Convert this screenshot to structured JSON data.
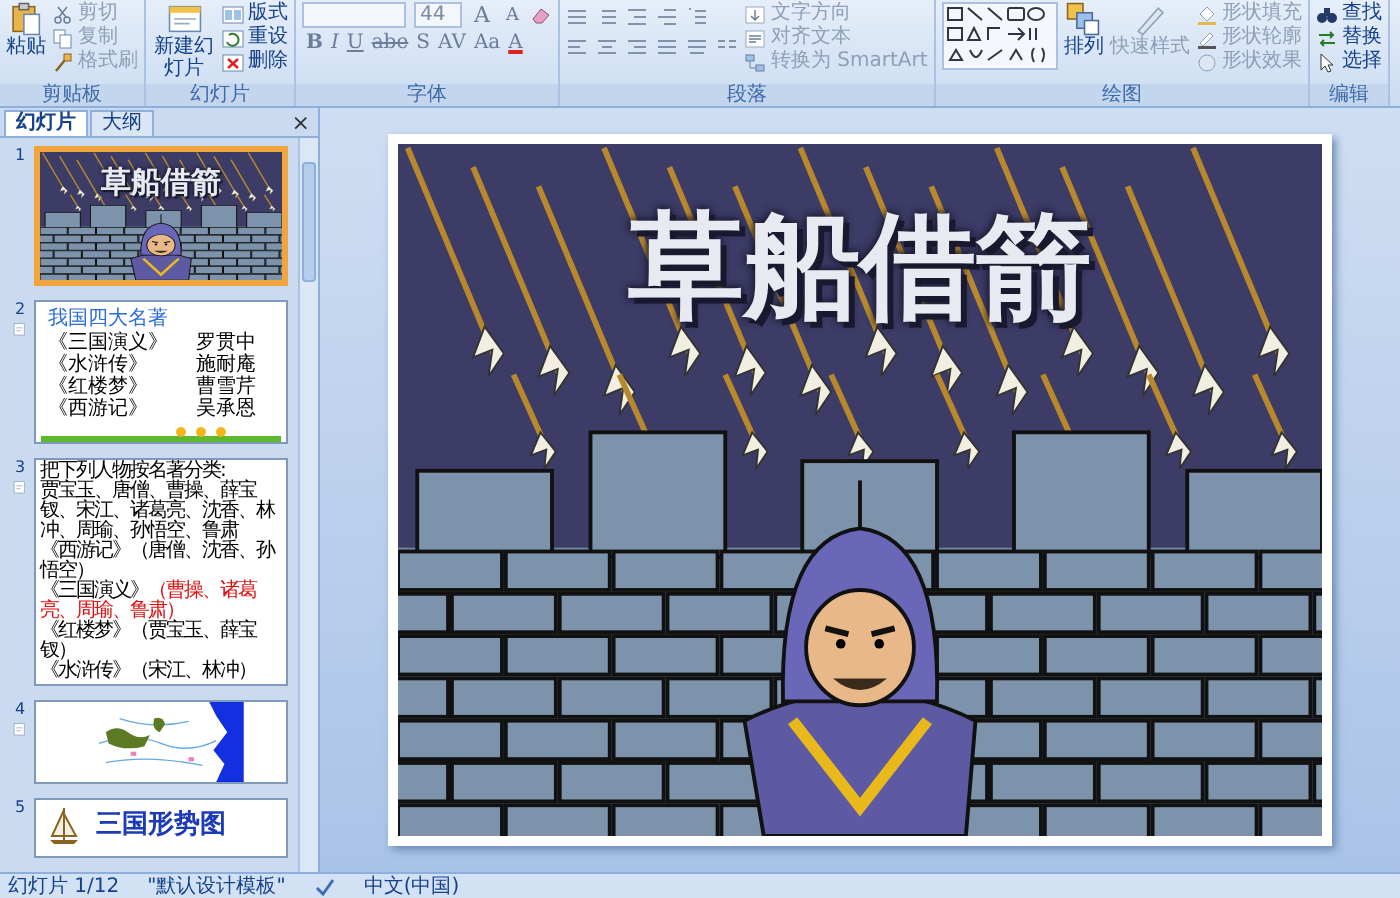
{
  "ribbon": {
    "groups": [
      {
        "kind": "clipboard",
        "label": "剪贴板",
        "large": [
          {
            "label": "粘贴",
            "disabled": false
          }
        ],
        "small": [
          {
            "label": "剪切",
            "disabled": true
          },
          {
            "label": "复制",
            "disabled": true
          },
          {
            "label": "格式刷",
            "disabled": true
          }
        ]
      },
      {
        "kind": "slides",
        "label": "幻灯片",
        "large": [
          {
            "label": "新建幻灯片",
            "disabled": false
          }
        ],
        "small": [
          {
            "label": "版式",
            "disabled": false
          },
          {
            "label": "重设",
            "disabled": false
          },
          {
            "label": "删除",
            "disabled": false
          }
        ]
      },
      {
        "kind": "font",
        "label": "字体",
        "font_size": "44",
        "size_buttons": [
          "A",
          "A"
        ],
        "format_buttons": [
          "B",
          "I",
          "U",
          "abe",
          "S",
          "AV",
          "Aa",
          "A"
        ]
      },
      {
        "kind": "paragraph",
        "label": "段落",
        "small": [
          {
            "label": "文字方向",
            "disabled": true
          },
          {
            "label": "对齐文本",
            "disabled": true
          },
          {
            "label": "转换为 SmartArt",
            "disabled": true
          }
        ]
      },
      {
        "kind": "drawing",
        "label": "绘图",
        "large": [
          {
            "label": "排列",
            "disabled": false
          },
          {
            "label": "快速样式",
            "disabled": true
          }
        ],
        "small": [
          {
            "label": "形状填充",
            "disabled": true
          },
          {
            "label": "形状轮廓",
            "disabled": true
          },
          {
            "label": "形状效果",
            "disabled": true
          }
        ]
      },
      {
        "kind": "editing",
        "label": "编辑",
        "small": [
          {
            "label": "查找",
            "disabled": false
          },
          {
            "label": "替换",
            "disabled": false
          },
          {
            "label": "选择",
            "disabled": false
          }
        ]
      }
    ]
  },
  "pane": {
    "tabs": [
      {
        "label": "幻灯片",
        "selected": true
      },
      {
        "label": "大纲",
        "selected": false
      }
    ],
    "close": "×"
  },
  "slides": [
    {
      "number": "1",
      "kind": "cover",
      "selected": true,
      "title": "草船借箭"
    },
    {
      "number": "2",
      "kind": "list",
      "selected": false,
      "heading": "我国四大名著",
      "rows": [
        {
          "book": "《三国演义》",
          "author": "罗贯中"
        },
        {
          "book": "《水浒传》",
          "author": "施耐庵"
        },
        {
          "book": "《红楼梦》",
          "author": "曹雪芹"
        },
        {
          "book": "《西游记》",
          "author": "吴承恩"
        }
      ]
    },
    {
      "number": "3",
      "kind": "exercise",
      "selected": false,
      "prompt": "把下列人物按名著分类:",
      "names": "贾宝玉、唐僧、曹操、薛宝钗、宋江、诸葛亮、沈香、林冲、周瑜、孙悟空、鲁肃",
      "rows": [
        {
          "book": "《西游记》",
          "answer": "（唐僧、沈香、孙悟空）",
          "highlighted": false
        },
        {
          "book": "《三国演义》",
          "answer": "（曹操、诸葛亮、周瑜、鲁肃）",
          "highlighted": true
        },
        {
          "book": "《红楼梦》",
          "answer": "（贾宝玉、薛宝钗）",
          "highlighted": false
        },
        {
          "book": "《水浒传》",
          "answer": "（宋江、林冲）",
          "highlighted": false
        }
      ]
    },
    {
      "number": "4",
      "kind": "map",
      "selected": false
    },
    {
      "number": "5",
      "kind": "title",
      "selected": false,
      "title": "三国形势图"
    }
  ],
  "main_slide": {
    "title": "草船借箭"
  },
  "status_bar": [
    "幻灯片 1/12",
    "\"默认设计模板\"",
    "中文(中国)"
  ]
}
